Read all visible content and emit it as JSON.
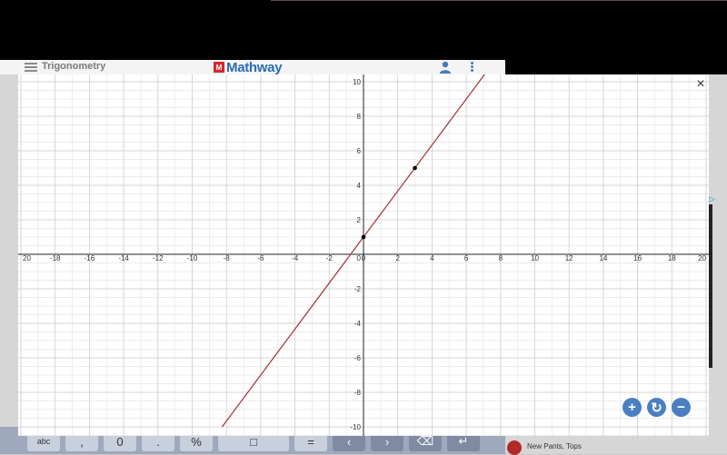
{
  "app": {
    "menu_icon": "hamburger-menu-icon",
    "subject": "Trigonometry",
    "brand": "Mathway",
    "brand_logo_text": "M",
    "user_icon": "user-icon",
    "more_icon": "more-vertical-icon"
  },
  "graph": {
    "close_icon": "close-icon",
    "close_label": "×",
    "zoom_in_label": "+",
    "reset_label": "↻",
    "zoom_out_label": "−",
    "colors": {
      "line": "#a0303a",
      "grid": "#e6e6e6",
      "axis": "#222222",
      "point": "#000000"
    }
  },
  "keyboard": {
    "keys": [
      "abc",
      ",",
      "0",
      ".",
      "%",
      "□",
      "=",
      "‹",
      "›",
      "⌫",
      "↵"
    ]
  },
  "ad": {
    "marker": "▷",
    "text": "New Pants, Tops"
  },
  "chart_data": {
    "type": "line",
    "xlim": [
      -20,
      20
    ],
    "ylim": [
      -10,
      10
    ],
    "x_ticks": [
      -20,
      -18,
      -16,
      -14,
      -12,
      -10,
      -8,
      -6,
      -4,
      -2,
      0,
      2,
      4,
      6,
      8,
      10,
      12,
      14,
      16,
      18,
      20
    ],
    "y_ticks": [
      -10,
      -8,
      -6,
      -4,
      -2,
      0,
      2,
      4,
      6,
      8,
      10
    ],
    "x_tick_labels": [
      "20",
      "-18",
      "-16",
      "-14",
      "-12",
      "-10",
      "-8",
      "-6",
      "-4",
      "-2",
      "0",
      "2",
      "4",
      "6",
      "8",
      "10",
      "12",
      "14",
      "16",
      "18",
      "20"
    ],
    "y_tick_labels": [
      "-10",
      "-8",
      "-6",
      "-4",
      "-2",
      "",
      "2",
      "4",
      "6",
      "8",
      "10"
    ],
    "grid": true,
    "series": [
      {
        "slope": 1.333,
        "intercept": 1
      }
    ],
    "points": [
      {
        "x": 0,
        "y": 1
      },
      {
        "x": 3,
        "y": 5
      }
    ]
  }
}
